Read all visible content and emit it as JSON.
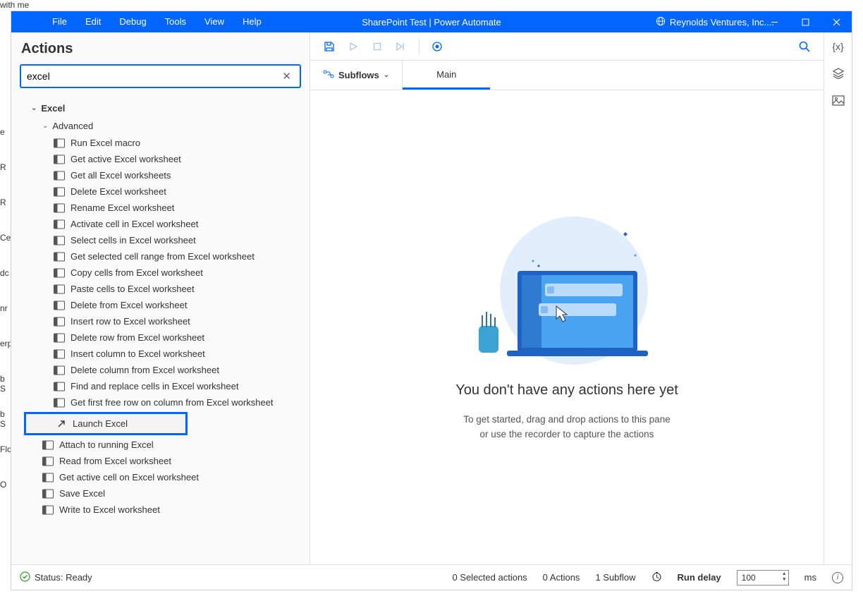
{
  "stray_top": "with me",
  "stray_left": [
    "e",
    "R",
    "R",
    "Ce",
    "dc",
    "nr",
    "erp",
    "b S",
    "b S",
    "Flo",
    "O"
  ],
  "menu": [
    "File",
    "Edit",
    "Debug",
    "Tools",
    "View",
    "Help"
  ],
  "window_title": "SharePoint Test | Power Automate",
  "org_name": "Reynolds Ventures, Inc....",
  "actions_panel": {
    "title": "Actions",
    "search_value": "excel",
    "group": "Excel",
    "subgroup": "Advanced",
    "items": [
      "Run Excel macro",
      "Get active Excel worksheet",
      "Get all Excel worksheets",
      "Delete Excel worksheet",
      "Rename Excel worksheet",
      "Activate cell in Excel worksheet",
      "Select cells in Excel worksheet",
      "Get selected cell range from Excel worksheet",
      "Copy cells from Excel worksheet",
      "Paste cells to Excel worksheet",
      "Delete from Excel worksheet",
      "Insert row to Excel worksheet",
      "Delete row from Excel worksheet",
      "Insert column to Excel worksheet",
      "Delete column from Excel worksheet",
      "Find and replace cells in Excel worksheet",
      "Get first free row on column from Excel worksheet"
    ],
    "highlighted": "Launch Excel",
    "items_after": [
      "Attach to running Excel",
      "Read from Excel worksheet",
      "Get active cell on Excel worksheet",
      "Save Excel",
      "Write to Excel worksheet"
    ]
  },
  "subflows_label": "Subflows",
  "tab_main": "Main",
  "empty": {
    "title": "You don't have any actions here yet",
    "line1": "To get started, drag and drop actions to this pane",
    "line2": "or use the recorder to capture the actions"
  },
  "status": {
    "ready": "Status: Ready",
    "selected": "0 Selected actions",
    "actions": "0 Actions",
    "subflow": "1 Subflow",
    "run_delay_label": "Run delay",
    "run_delay_value": "100",
    "ms": "ms"
  }
}
